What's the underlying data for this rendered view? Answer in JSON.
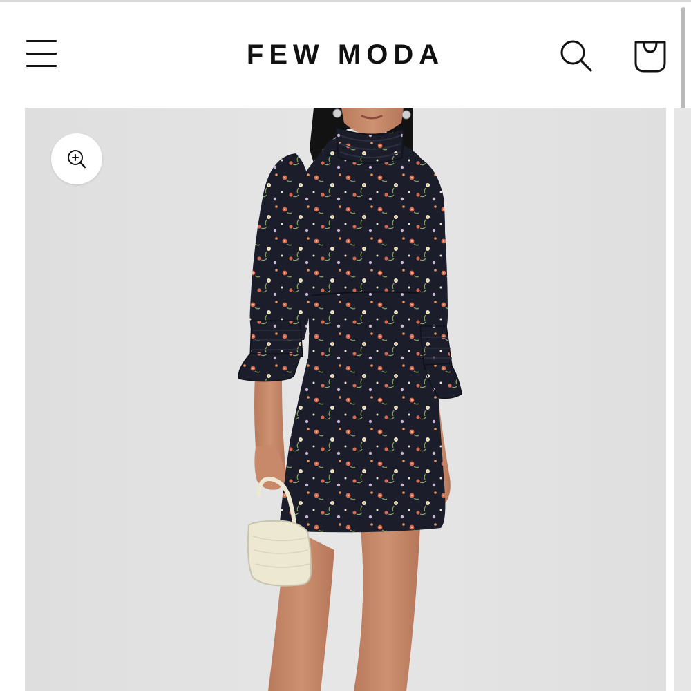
{
  "header": {
    "brand": "FEW MODA",
    "menu_icon": "hamburger-menu-icon",
    "search_icon": "search-icon",
    "cart_icon": "shopping-bag-icon"
  },
  "gallery": {
    "zoom_icon": "zoom-in-icon",
    "image_subject": "floral-print-mini-dress",
    "colors": {
      "background": "#e3e3e3",
      "dress": "#1b1d2a",
      "flower_red": "#d86a55",
      "flower_cream": "#efe6d2",
      "leaf": "#7f9b5b",
      "skin": "#c68a6a",
      "bag": "#ece8d2"
    }
  }
}
